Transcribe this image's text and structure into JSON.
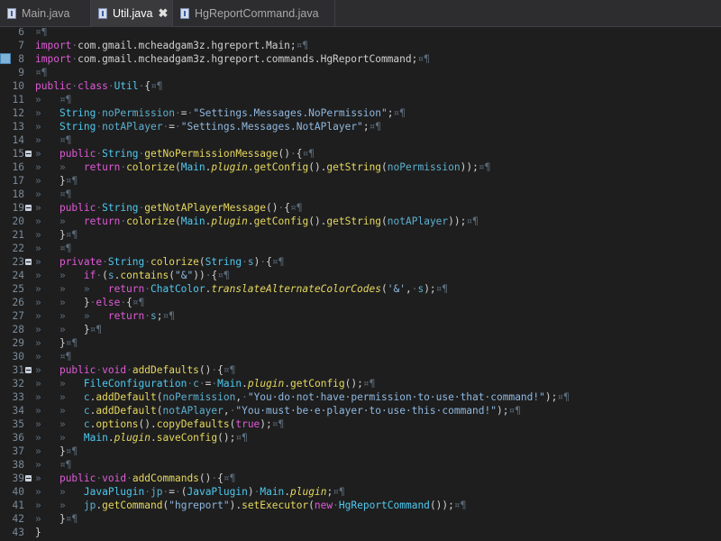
{
  "tabs": [
    {
      "label": "Main.java",
      "active": false
    },
    {
      "label": "Util.java",
      "active": true,
      "close": "✖"
    },
    {
      "label": "HgReportCommand.java",
      "active": false
    }
  ],
  "gutter": {
    "line_numbers": [
      "6",
      "7",
      "8",
      "9",
      "10",
      "11",
      "12",
      "13",
      "14",
      "15",
      "16",
      "17",
      "18",
      "19",
      "20",
      "21",
      "22",
      "23",
      "24",
      "25",
      "26",
      "27",
      "28",
      "29",
      "30",
      "31",
      "32",
      "33",
      "34",
      "35",
      "36",
      "37",
      "38",
      "39",
      "40",
      "41",
      "42",
      "43"
    ]
  },
  "code_lines": [
    [
      [
        "ws",
        "¤¶"
      ]
    ],
    [
      [
        "kw",
        "import"
      ],
      [
        "ws",
        "·"
      ],
      [
        "pn",
        "com.gmail.mcheadgam3z.hgreport.Main;"
      ],
      [
        "ws",
        "¤¶"
      ]
    ],
    [
      [
        "kw",
        "import"
      ],
      [
        "ws",
        "·"
      ],
      [
        "pn",
        "com.gmail.mcheadgam3z.hgreport.commands.HgReportCommand;"
      ],
      [
        "ws",
        "¤¶"
      ]
    ],
    [
      [
        "ws",
        "¤¶"
      ]
    ],
    [
      [
        "kw",
        "public"
      ],
      [
        "ws",
        "·"
      ],
      [
        "kw",
        "class"
      ],
      [
        "ws",
        "·"
      ],
      [
        "ty",
        "Util"
      ],
      [
        "ws",
        "·"
      ],
      [
        "pn",
        "{"
      ],
      [
        "ws",
        "¤¶"
      ]
    ],
    [
      [
        "ws",
        "»   ¤¶"
      ]
    ],
    [
      [
        "ws",
        "»   "
      ],
      [
        "ty",
        "String"
      ],
      [
        "ws",
        "·"
      ],
      [
        "var",
        "noPermission"
      ],
      [
        "ws",
        "·"
      ],
      [
        "pn",
        "="
      ],
      [
        "ws",
        "·"
      ],
      [
        "st",
        "\"Settings.Messages.NoPermission\""
      ],
      [
        "pn",
        ";"
      ],
      [
        "ws",
        "¤¶"
      ]
    ],
    [
      [
        "ws",
        "»   "
      ],
      [
        "ty",
        "String"
      ],
      [
        "ws",
        "·"
      ],
      [
        "var",
        "notAPlayer"
      ],
      [
        "ws",
        "·"
      ],
      [
        "pn",
        "="
      ],
      [
        "ws",
        "·"
      ],
      [
        "st",
        "\"Settings.Messages.NotAPlayer\""
      ],
      [
        "pn",
        ";"
      ],
      [
        "ws",
        "¤¶"
      ]
    ],
    [
      [
        "ws",
        "»   ¤¶"
      ]
    ],
    [
      [
        "ws",
        "»   "
      ],
      [
        "kw",
        "public"
      ],
      [
        "ws",
        "·"
      ],
      [
        "ty",
        "String"
      ],
      [
        "ws",
        "·"
      ],
      [
        "fn",
        "getNoPermissionMessage"
      ],
      [
        "pn",
        "()"
      ],
      [
        "ws",
        "·"
      ],
      [
        "pn",
        "{"
      ],
      [
        "ws",
        "¤¶"
      ]
    ],
    [
      [
        "ws",
        "»   »   "
      ],
      [
        "kw",
        "return"
      ],
      [
        "ws",
        "·"
      ],
      [
        "fn",
        "colorize"
      ],
      [
        "pn",
        "("
      ],
      [
        "ty",
        "Main"
      ],
      [
        "pn",
        "."
      ],
      [
        "it",
        "plugin"
      ],
      [
        "pn",
        "."
      ],
      [
        "fn",
        "getConfig"
      ],
      [
        "pn",
        "()."
      ],
      [
        "fn",
        "getString"
      ],
      [
        "pn",
        "("
      ],
      [
        "var",
        "noPermission"
      ],
      [
        "pn",
        "));"
      ],
      [
        "ws",
        "¤¶"
      ]
    ],
    [
      [
        "ws",
        "»   "
      ],
      [
        "pn",
        "}"
      ],
      [
        "ws",
        "¤¶"
      ]
    ],
    [
      [
        "ws",
        "»   ¤¶"
      ]
    ],
    [
      [
        "ws",
        "»   "
      ],
      [
        "kw",
        "public"
      ],
      [
        "ws",
        "·"
      ],
      [
        "ty",
        "String"
      ],
      [
        "ws",
        "·"
      ],
      [
        "fn",
        "getNotAPlayerMessage"
      ],
      [
        "pn",
        "()"
      ],
      [
        "ws",
        "·"
      ],
      [
        "pn",
        "{"
      ],
      [
        "ws",
        "¤¶"
      ]
    ],
    [
      [
        "ws",
        "»   »   "
      ],
      [
        "kw",
        "return"
      ],
      [
        "ws",
        "·"
      ],
      [
        "fn",
        "colorize"
      ],
      [
        "pn",
        "("
      ],
      [
        "ty",
        "Main"
      ],
      [
        "pn",
        "."
      ],
      [
        "it",
        "plugin"
      ],
      [
        "pn",
        "."
      ],
      [
        "fn",
        "getConfig"
      ],
      [
        "pn",
        "()."
      ],
      [
        "fn",
        "getString"
      ],
      [
        "pn",
        "("
      ],
      [
        "var",
        "notAPlayer"
      ],
      [
        "pn",
        "));"
      ],
      [
        "ws",
        "¤¶"
      ]
    ],
    [
      [
        "ws",
        "»   "
      ],
      [
        "pn",
        "}"
      ],
      [
        "ws",
        "¤¶"
      ]
    ],
    [
      [
        "ws",
        "»   ¤¶"
      ]
    ],
    [
      [
        "ws",
        "»   "
      ],
      [
        "kw",
        "private"
      ],
      [
        "ws",
        "·"
      ],
      [
        "ty",
        "String"
      ],
      [
        "ws",
        "·"
      ],
      [
        "fn",
        "colorize"
      ],
      [
        "pn",
        "("
      ],
      [
        "ty",
        "String"
      ],
      [
        "ws",
        "·"
      ],
      [
        "var",
        "s"
      ],
      [
        "pn",
        ")"
      ],
      [
        "ws",
        "·"
      ],
      [
        "pn",
        "{"
      ],
      [
        "ws",
        "¤¶"
      ]
    ],
    [
      [
        "ws",
        "»   »   "
      ],
      [
        "kw",
        "if"
      ],
      [
        "ws",
        "·"
      ],
      [
        "pn",
        "("
      ],
      [
        "var",
        "s"
      ],
      [
        "pn",
        "."
      ],
      [
        "fn",
        "contains"
      ],
      [
        "pn",
        "("
      ],
      [
        "st",
        "\"&\""
      ],
      [
        "pn",
        "))"
      ],
      [
        "ws",
        "·"
      ],
      [
        "pn",
        "{"
      ],
      [
        "ws",
        "¤¶"
      ]
    ],
    [
      [
        "ws",
        "»   »   »   "
      ],
      [
        "kw",
        "return"
      ],
      [
        "ws",
        "·"
      ],
      [
        "ty",
        "ChatColor"
      ],
      [
        "pn",
        "."
      ],
      [
        "it",
        "translateAlternateColorCodes"
      ],
      [
        "pn",
        "("
      ],
      [
        "st",
        "'&'"
      ],
      [
        "pn",
        ","
      ],
      [
        "ws",
        "·"
      ],
      [
        "var",
        "s"
      ],
      [
        "pn",
        ");"
      ],
      [
        "ws",
        "¤¶"
      ]
    ],
    [
      [
        "ws",
        "»   »   "
      ],
      [
        "pn",
        "}"
      ],
      [
        "ws",
        "·"
      ],
      [
        "kw",
        "else"
      ],
      [
        "ws",
        "·"
      ],
      [
        "pn",
        "{"
      ],
      [
        "ws",
        "¤¶"
      ]
    ],
    [
      [
        "ws",
        "»   »   »   "
      ],
      [
        "kw",
        "return"
      ],
      [
        "ws",
        "·"
      ],
      [
        "var",
        "s"
      ],
      [
        "pn",
        ";"
      ],
      [
        "ws",
        "¤¶"
      ]
    ],
    [
      [
        "ws",
        "»   »   "
      ],
      [
        "pn",
        "}"
      ],
      [
        "ws",
        "¤¶"
      ]
    ],
    [
      [
        "ws",
        "»   "
      ],
      [
        "pn",
        "}"
      ],
      [
        "ws",
        "¤¶"
      ]
    ],
    [
      [
        "ws",
        "»   ¤¶"
      ]
    ],
    [
      [
        "ws",
        "»   "
      ],
      [
        "kw",
        "public"
      ],
      [
        "ws",
        "·"
      ],
      [
        "kw",
        "void"
      ],
      [
        "ws",
        "·"
      ],
      [
        "fn",
        "addDefaults"
      ],
      [
        "pn",
        "()"
      ],
      [
        "ws",
        "·"
      ],
      [
        "pn",
        "{"
      ],
      [
        "ws",
        "¤¶"
      ]
    ],
    [
      [
        "ws",
        "»   »   "
      ],
      [
        "ty",
        "FileConfiguration"
      ],
      [
        "ws",
        "·"
      ],
      [
        "var",
        "c"
      ],
      [
        "ws",
        "·"
      ],
      [
        "pn",
        "="
      ],
      [
        "ws",
        "·"
      ],
      [
        "ty",
        "Main"
      ],
      [
        "pn",
        "."
      ],
      [
        "it",
        "plugin"
      ],
      [
        "pn",
        "."
      ],
      [
        "fn",
        "getConfig"
      ],
      [
        "pn",
        "();"
      ],
      [
        "ws",
        "¤¶"
      ]
    ],
    [
      [
        "ws",
        "»   »   "
      ],
      [
        "var",
        "c"
      ],
      [
        "pn",
        "."
      ],
      [
        "fn",
        "addDefault"
      ],
      [
        "pn",
        "("
      ],
      [
        "var",
        "noPermission"
      ],
      [
        "pn",
        ","
      ],
      [
        "ws",
        "·"
      ],
      [
        "st",
        "\"You·do·not·have·permission·to·use·that·command!\""
      ],
      [
        "pn",
        ");"
      ],
      [
        "ws",
        "¤¶"
      ]
    ],
    [
      [
        "ws",
        "»   »   "
      ],
      [
        "var",
        "c"
      ],
      [
        "pn",
        "."
      ],
      [
        "fn",
        "addDefault"
      ],
      [
        "pn",
        "("
      ],
      [
        "var",
        "notAPlayer"
      ],
      [
        "pn",
        ","
      ],
      [
        "ws",
        "·"
      ],
      [
        "st",
        "\"You·must·be·e·player·to·use·this·command!\""
      ],
      [
        "pn",
        ");"
      ],
      [
        "ws",
        "¤¶"
      ]
    ],
    [
      [
        "ws",
        "»   »   "
      ],
      [
        "var",
        "c"
      ],
      [
        "pn",
        "."
      ],
      [
        "fn",
        "options"
      ],
      [
        "pn",
        "()."
      ],
      [
        "fn",
        "copyDefaults"
      ],
      [
        "pn",
        "("
      ],
      [
        "kw",
        "true"
      ],
      [
        "pn",
        ");"
      ],
      [
        "ws",
        "¤¶"
      ]
    ],
    [
      [
        "ws",
        "»   »   "
      ],
      [
        "ty",
        "Main"
      ],
      [
        "pn",
        "."
      ],
      [
        "it",
        "plugin"
      ],
      [
        "pn",
        "."
      ],
      [
        "fn",
        "saveConfig"
      ],
      [
        "pn",
        "();"
      ],
      [
        "ws",
        "¤¶"
      ]
    ],
    [
      [
        "ws",
        "»   "
      ],
      [
        "pn",
        "}"
      ],
      [
        "ws",
        "¤¶"
      ]
    ],
    [
      [
        "ws",
        "»   ¤¶"
      ]
    ],
    [
      [
        "ws",
        "»   "
      ],
      [
        "kw",
        "public"
      ],
      [
        "ws",
        "·"
      ],
      [
        "kw",
        "void"
      ],
      [
        "ws",
        "·"
      ],
      [
        "fn",
        "addCommands"
      ],
      [
        "pn",
        "()"
      ],
      [
        "ws",
        "·"
      ],
      [
        "pn",
        "{"
      ],
      [
        "ws",
        "¤¶"
      ]
    ],
    [
      [
        "ws",
        "»   »   "
      ],
      [
        "ty",
        "JavaPlugin"
      ],
      [
        "ws",
        "·"
      ],
      [
        "var",
        "jp"
      ],
      [
        "ws",
        "·"
      ],
      [
        "pn",
        "="
      ],
      [
        "ws",
        "·"
      ],
      [
        "pn",
        "("
      ],
      [
        "ty",
        "JavaPlugin"
      ],
      [
        "pn",
        ")"
      ],
      [
        "ws",
        "·"
      ],
      [
        "ty",
        "Main"
      ],
      [
        "pn",
        "."
      ],
      [
        "it",
        "plugin"
      ],
      [
        "pn",
        ";"
      ],
      [
        "ws",
        "¤¶"
      ]
    ],
    [
      [
        "ws",
        "»   »   "
      ],
      [
        "var",
        "jp"
      ],
      [
        "pn",
        "."
      ],
      [
        "fn",
        "getCommand"
      ],
      [
        "pn",
        "("
      ],
      [
        "st",
        "\"hgreport\""
      ],
      [
        "pn",
        ")."
      ],
      [
        "fn",
        "setExecutor"
      ],
      [
        "pn",
        "("
      ],
      [
        "kw",
        "new"
      ],
      [
        "ws",
        "·"
      ],
      [
        "ty",
        "HgReportCommand"
      ],
      [
        "pn",
        "());"
      ],
      [
        "ws",
        "¤¶"
      ]
    ],
    [
      [
        "ws",
        "»   "
      ],
      [
        "pn",
        "}"
      ],
      [
        "ws",
        "¤¶"
      ]
    ],
    [
      [
        "pn",
        "}"
      ]
    ]
  ],
  "fold_lines": [
    "15",
    "19",
    "23",
    "31",
    "39"
  ],
  "marker_lines": [
    "8"
  ]
}
